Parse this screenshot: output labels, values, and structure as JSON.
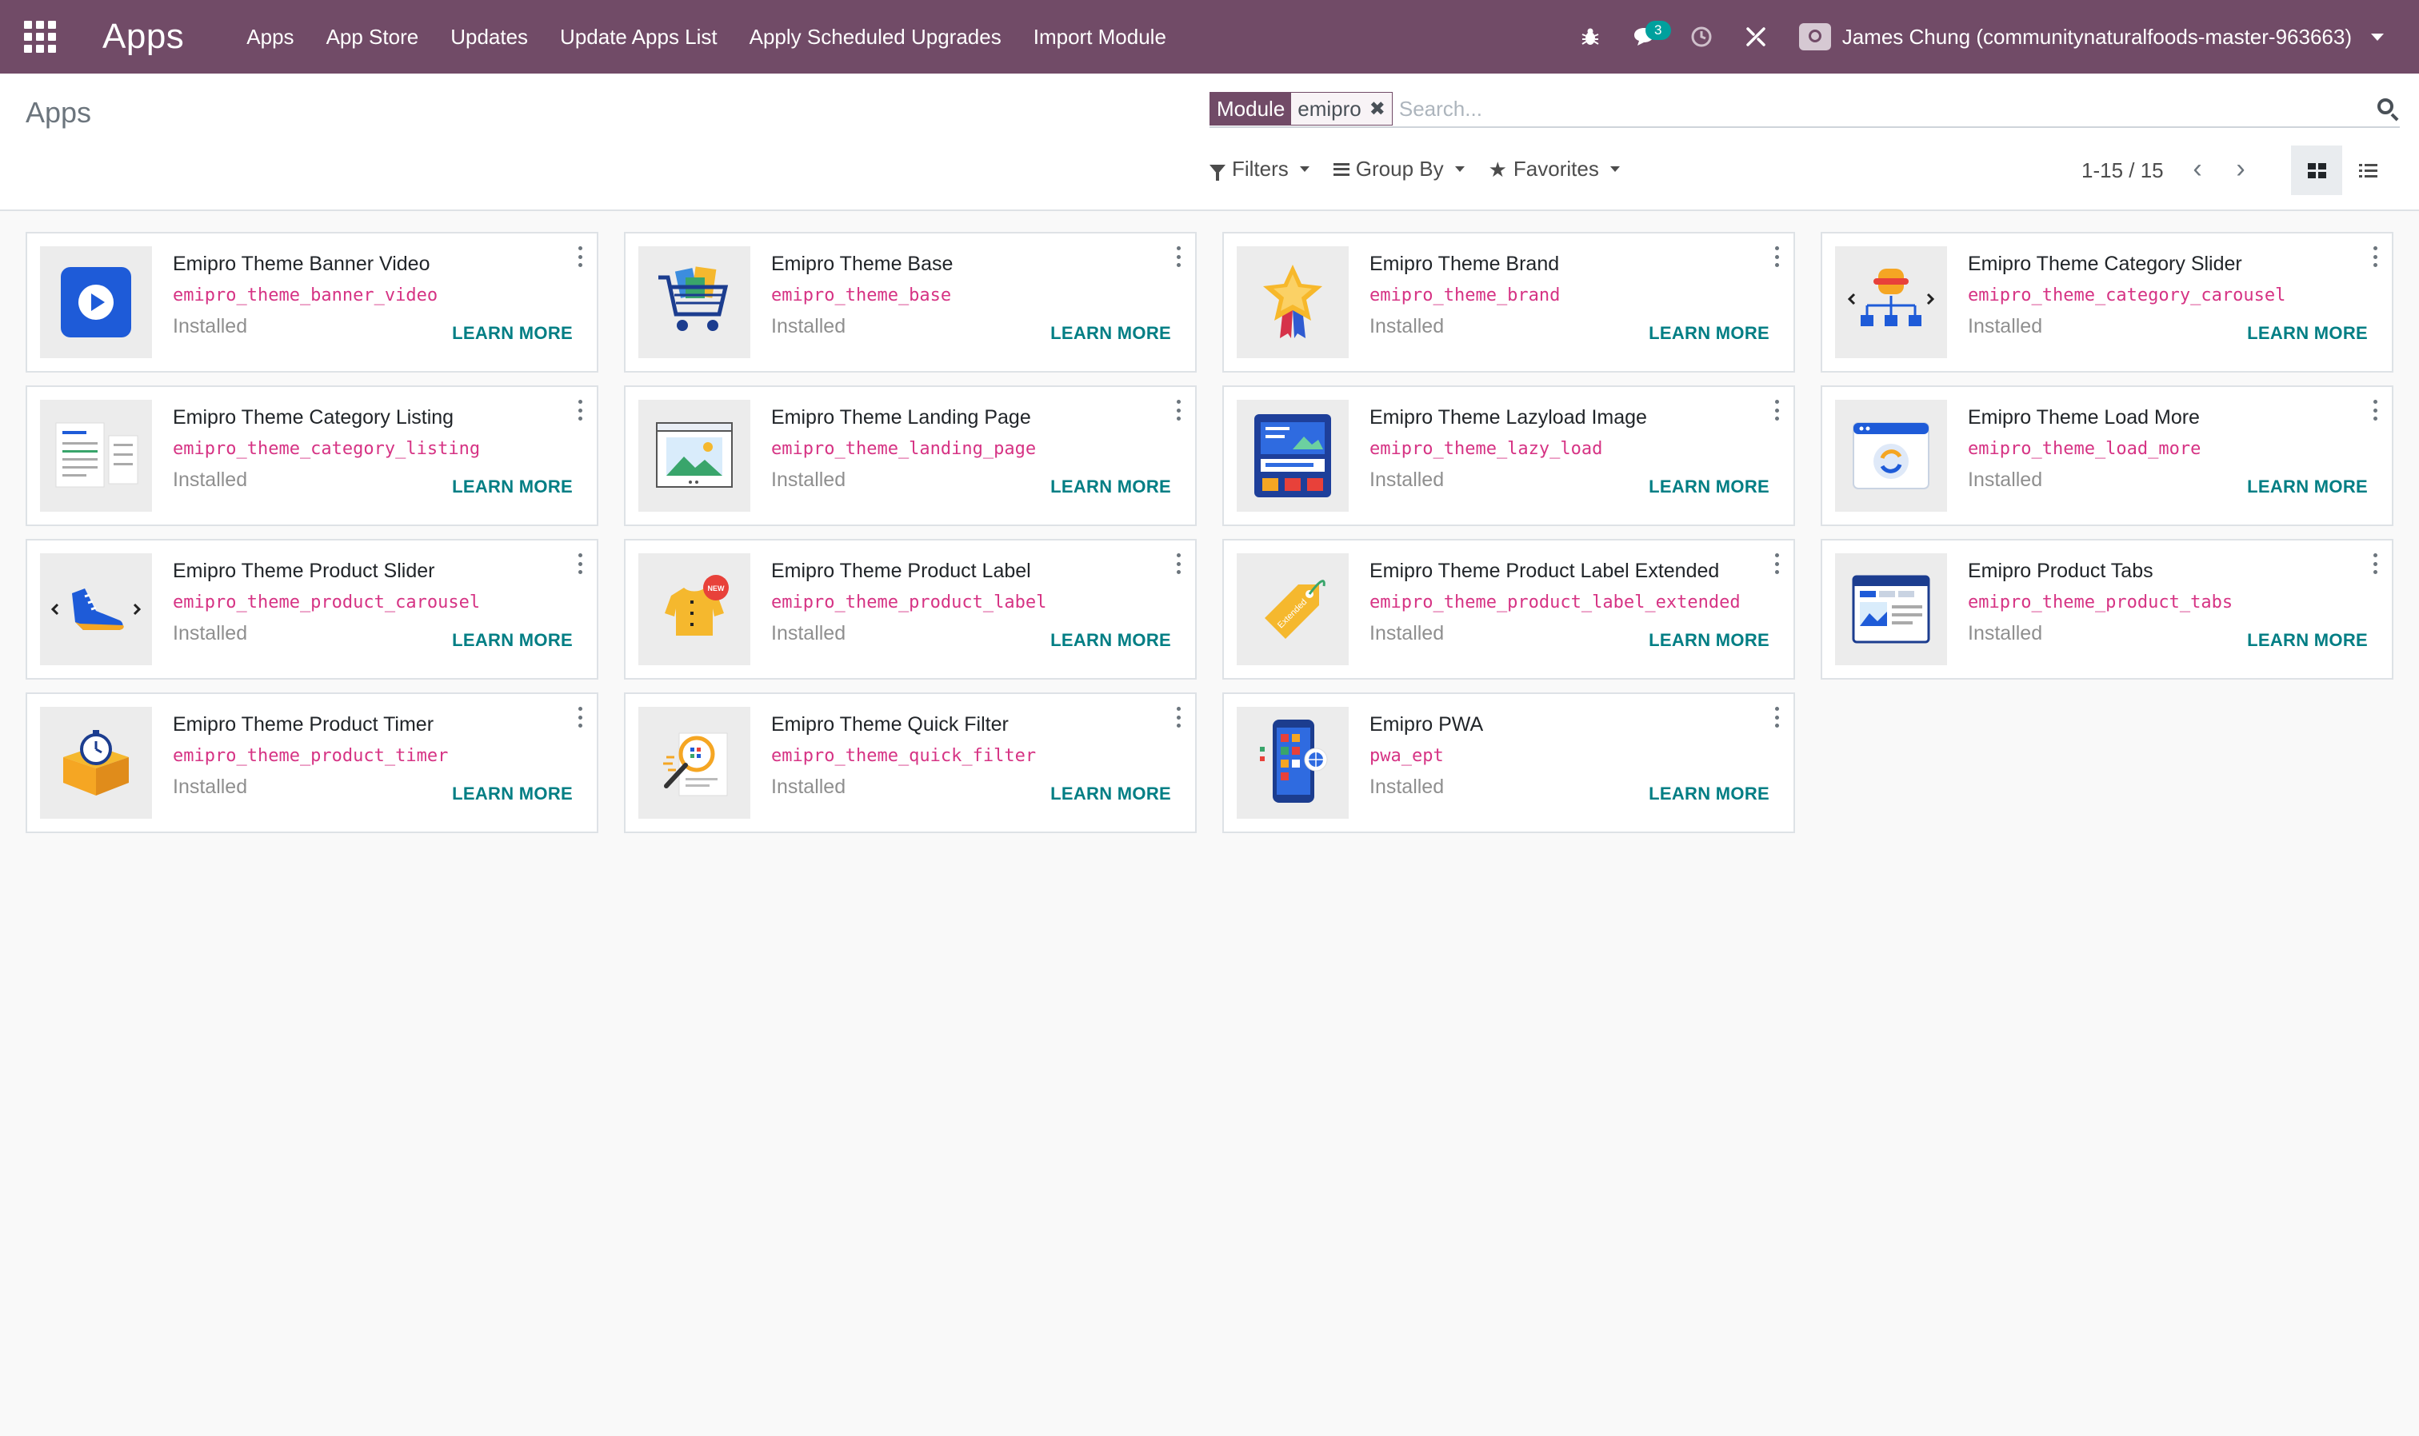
{
  "navbar": {
    "brand": "Apps",
    "menu": [
      "Apps",
      "App Store",
      "Updates",
      "Update Apps List",
      "Apply Scheduled Upgrades",
      "Import Module"
    ],
    "messages_badge": "3",
    "user_name": "James Chung (communitynaturalfoods-master-963663)",
    "icons": [
      "apps-grid-icon",
      "bug-icon",
      "chat-icon",
      "clock-icon",
      "tools-icon",
      "avatar"
    ],
    "color": "#714b67"
  },
  "control_panel": {
    "breadcrumb": "Apps",
    "facet": {
      "label": "Module",
      "value": "emipro"
    },
    "search_placeholder": "Search...",
    "filters_label": "Filters",
    "groupby_label": "Group By",
    "favorites_label": "Favorites",
    "pager_value": "1-15 / 15"
  },
  "modules": [
    {
      "title": "Emipro Theme Banner Video",
      "tech": "emipro_theme_banner_video",
      "status": "Installed",
      "action": "LEARN MORE",
      "icon": "play-video-icon"
    },
    {
      "title": "Emipro Theme Base",
      "tech": "emipro_theme_base",
      "status": "Installed",
      "action": "LEARN MORE",
      "icon": "shopping-cart-icon"
    },
    {
      "title": "Emipro Theme Brand",
      "tech": "emipro_theme_brand",
      "status": "Installed",
      "action": "LEARN MORE",
      "icon": "star-medal-icon"
    },
    {
      "title": "Emipro Theme Category Slider",
      "tech": "emipro_theme_category_carousel",
      "status": "Installed",
      "action": "LEARN MORE",
      "icon": "category-slider-icon"
    },
    {
      "title": "Emipro Theme Category Listing",
      "tech": "emipro_theme_category_listing",
      "status": "Installed",
      "action": "LEARN MORE",
      "icon": "category-listing-icon"
    },
    {
      "title": "Emipro Theme Landing Page",
      "tech": "emipro_theme_landing_page",
      "status": "Installed",
      "action": "LEARN MORE",
      "icon": "landing-page-icon"
    },
    {
      "title": "Emipro Theme Lazyload Image",
      "tech": "emipro_theme_lazy_load",
      "status": "Installed",
      "action": "LEARN MORE",
      "icon": "lazyload-image-icon"
    },
    {
      "title": "Emipro Theme Load More",
      "tech": "emipro_theme_load_more",
      "status": "Installed",
      "action": "LEARN MORE",
      "icon": "load-more-icon"
    },
    {
      "title": "Emipro Theme Product Slider",
      "tech": "emipro_theme_product_carousel",
      "status": "Installed",
      "action": "LEARN MORE",
      "icon": "shoe-slider-icon"
    },
    {
      "title": "Emipro Theme Product Label",
      "tech": "emipro_theme_product_label",
      "status": "Installed",
      "action": "LEARN MORE",
      "icon": "product-label-icon",
      "icon_text": "NEW"
    },
    {
      "title": "Emipro Theme Product Label Extended",
      "tech": "emipro_theme_product_label_extended",
      "status": "Installed",
      "action": "LEARN MORE",
      "icon": "tag-extended-icon",
      "icon_text": "Extended"
    },
    {
      "title": "Emipro Product Tabs",
      "tech": "emipro_theme_product_tabs",
      "status": "Installed",
      "action": "LEARN MORE",
      "icon": "product-tabs-icon"
    },
    {
      "title": "Emipro Theme Product Timer",
      "tech": "emipro_theme_product_timer",
      "status": "Installed",
      "action": "LEARN MORE",
      "icon": "timer-box-icon"
    },
    {
      "title": "Emipro Theme Quick Filter",
      "tech": "emipro_theme_quick_filter",
      "status": "Installed",
      "action": "LEARN MORE",
      "icon": "quick-filter-icon"
    },
    {
      "title": "Emipro PWA",
      "tech": "pwa_ept",
      "status": "Installed",
      "action": "LEARN MORE",
      "icon": "pwa-phone-icon"
    }
  ]
}
